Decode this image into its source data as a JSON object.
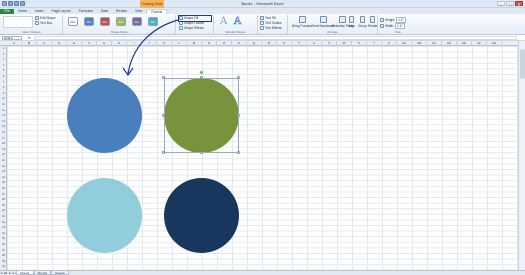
{
  "window": {
    "title": "Book1 - Microsoft Excel",
    "context_tab": "Drawing Tools",
    "controls": [
      "–",
      "□",
      "✕"
    ]
  },
  "tabs": [
    {
      "label": "File"
    },
    {
      "label": "Home"
    },
    {
      "label": "Insert"
    },
    {
      "label": "Page Layout"
    },
    {
      "label": "Formulas"
    },
    {
      "label": "Data"
    },
    {
      "label": "Review"
    },
    {
      "label": "View"
    },
    {
      "label": "Format"
    }
  ],
  "ribbon": {
    "insert_shapes": {
      "label": "Insert Shapes",
      "edit_shape": "Edit Shape",
      "text_box": "Text Box"
    },
    "shape_styles": {
      "label": "Shape Styles",
      "swatch_text": "Abc",
      "shape_fill": "Shape Fill",
      "shape_outline": "Shape Outline",
      "shape_effects": "Shape Effects"
    },
    "wordart_styles": {
      "label": "WordArt Styles",
      "text_fill": "Text Fill",
      "text_outline": "Text Outline",
      "text_effects": "Text Effects"
    },
    "arrange": {
      "label": "Arrange",
      "bring_forward": "Bring Forward",
      "send_backward": "Send Backward",
      "selection_pane": "Selection Pane",
      "align": "Align",
      "group": "Group",
      "rotate": "Rotate"
    },
    "size": {
      "label": "Size",
      "height_label": "Height:",
      "height_value": "1.4\"",
      "width_label": "Width:",
      "width_value": "1.4\""
    }
  },
  "formula_bar": {
    "name_box": "Oval 2",
    "fx": "fx",
    "formula": ""
  },
  "columns": [
    "A",
    "B",
    "C",
    "D",
    "E",
    "F",
    "G",
    "H",
    "I",
    "J",
    "K",
    "L",
    "M",
    "N",
    "O",
    "P",
    "Q",
    "R",
    "S",
    "T",
    "U",
    "V",
    "W",
    "X",
    "Y",
    "Z",
    "AA",
    "AB",
    "AC",
    "AD",
    "AE",
    "AF",
    "AG"
  ],
  "rows": [
    "1",
    "2",
    "3",
    "4",
    "5",
    "6",
    "7",
    "8",
    "9",
    "10",
    "11",
    "12",
    "13",
    "14",
    "15",
    "16",
    "17",
    "18",
    "19",
    "20",
    "21",
    "22",
    "23",
    "24",
    "25",
    "26",
    "27",
    "28",
    "29",
    "30",
    "31",
    "32",
    "33",
    "34",
    "35",
    "36",
    "37",
    "38",
    "39",
    "40"
  ],
  "sheets": {
    "nav": [
      "◄◄",
      "◄",
      "►",
      "►►"
    ],
    "tabs": [
      "Sheet1",
      "Sheet2",
      "Sheet3"
    ]
  },
  "colors": {
    "circle_top_left": "#4a7fbd",
    "circle_top_right": "#77933c",
    "circle_bottom_left": "#92cddc",
    "circle_bottom_right": "#17375e",
    "annotation_arrow": "#1b3a8c",
    "swatches": [
      "#ffffff",
      "#4f81bd",
      "#c0504d",
      "#9bbb59",
      "#8064a2",
      "#4bacc6"
    ]
  }
}
